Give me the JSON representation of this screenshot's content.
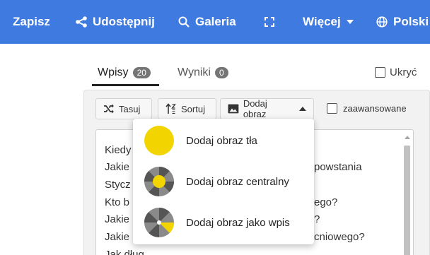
{
  "topbar": {
    "save": "Zapisz",
    "share": "Udostępnij",
    "gallery": "Galeria",
    "more": "Więcej",
    "language": "Polski",
    "background_color": "#3f7ae0"
  },
  "tabs": [
    {
      "label": "Wpisy",
      "count": "20",
      "active": true
    },
    {
      "label": "Wyniki",
      "count": "0",
      "active": false
    }
  ],
  "hide_label": "Ukryć",
  "toolbar": {
    "shuffle": "Tasuj",
    "sort": "Sortuj",
    "add_image": "Dodaj obraz",
    "advanced": "zaawansowane"
  },
  "entries": [
    "Kiedy",
    "Jakie",
    "powstania",
    "Stycz",
    "Kto b",
    "ego?",
    "Jakie",
    "?",
    "Jakie",
    "cniowego?",
    "Jak dług"
  ],
  "menu": {
    "items": [
      {
        "label": "Dodaj obraz tła",
        "icon": "yellow-circle-icon"
      },
      {
        "label": "Dodaj obraz centralny",
        "icon": "wheel-center-icon"
      },
      {
        "label": "Dodaj obraz jako wpis",
        "icon": "wheel-slice-icon"
      }
    ],
    "accent_color": "#f2d500"
  }
}
